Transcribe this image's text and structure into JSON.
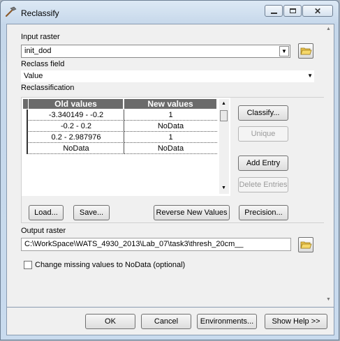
{
  "window": {
    "title": "Reclassify"
  },
  "input_raster": {
    "label": "Input raster",
    "value": "init_dod"
  },
  "reclass_field": {
    "label": "Reclass field",
    "value": "Value"
  },
  "reclassification": {
    "label": "Reclassification",
    "columns": [
      "Old values",
      "New values"
    ],
    "rows": [
      {
        "old": "-3.340149 - -0.2",
        "new": "1"
      },
      {
        "old": "-0.2 - 0.2",
        "new": "NoData"
      },
      {
        "old": "0.2 - 2.987976",
        "new": "1"
      },
      {
        "old": "NoData",
        "new": "NoData"
      }
    ],
    "buttons": {
      "classify": "Classify...",
      "unique": "Unique",
      "add_entry": "Add Entry",
      "delete_entries": "Delete Entries",
      "load": "Load...",
      "save": "Save...",
      "reverse": "Reverse New Values",
      "precision": "Precision..."
    }
  },
  "output_raster": {
    "label": "Output raster",
    "value": "C:\\WorkSpace\\WATS_4930_2013\\Lab_07\\task3\\thresh_20cm__"
  },
  "missing_values": {
    "label": "Change missing values to NoData (optional)",
    "checked": false
  },
  "footer": {
    "ok": "OK",
    "cancel": "Cancel",
    "environments": "Environments...",
    "show_help": "Show Help >>"
  },
  "icons": {
    "app": "hammer-icon",
    "minimize": "minimize-icon",
    "maximize": "maximize-icon",
    "close": "close-icon",
    "folder": "open-folder-icon"
  }
}
